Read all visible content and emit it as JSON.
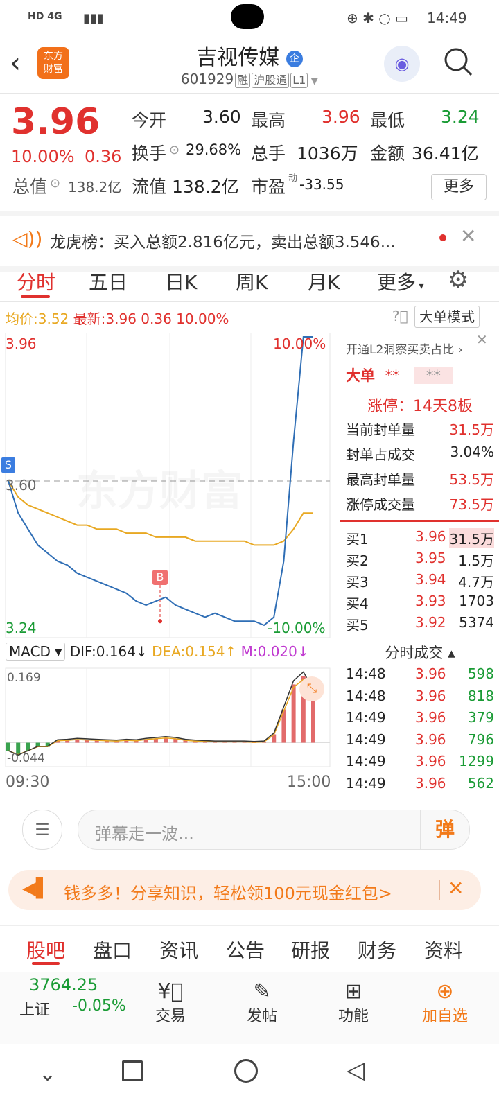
{
  "status_bar": {
    "left_icons": "HD 4G",
    "time": "14:49"
  },
  "header": {
    "stock_name": "吉视传媒",
    "stock_code": "601929",
    "tags": [
      "融",
      "沪股通",
      "L1"
    ]
  },
  "quote": {
    "price": "3.96",
    "change_pct": "10.00%",
    "change": "0.36",
    "open_label": "今开",
    "open": "3.60",
    "high_label": "最高",
    "high": "3.96",
    "low_label": "最低",
    "low": "3.24",
    "turnover_label": "换手",
    "turnover": "29.68%",
    "volume_label": "总手",
    "volume": "1036万",
    "amount_label": "金额",
    "amount": "36.41亿",
    "mktcap_label": "总值",
    "mktcap": "138.2亿",
    "float_label": "流值",
    "float_cap": "138.2亿",
    "pe_label": "市盈",
    "pe_sup": "动",
    "pe": "-33.55",
    "more_button": "更多"
  },
  "notice": {
    "text": "龙虎榜：买入总额2.816亿元，卖出总额3.546..."
  },
  "tabs": [
    "分时",
    "五日",
    "日K",
    "周K",
    "月K",
    "更多"
  ],
  "summary": {
    "avg_label": "均价:",
    "avg": "3.52",
    "latest_label": "最新:",
    "latest": "3.96",
    "change": "0.36",
    "pct": "10.00%",
    "mode_button": "大单模式"
  },
  "chart_data": {
    "type": "line",
    "price_top": "3.96",
    "price_bottom": "3.24",
    "pct_top": "10.00%",
    "pct_bottom": "-10.00%",
    "ref_price": "3.60",
    "time_start": "09:30",
    "time_end": "15:00",
    "watermark": "东方财富",
    "marker_s": "S",
    "marker_b": "B",
    "ylim": [
      3.24,
      3.96
    ],
    "price_series": [
      3.6,
      3.52,
      3.48,
      3.44,
      3.42,
      3.4,
      3.39,
      3.37,
      3.36,
      3.35,
      3.34,
      3.33,
      3.32,
      3.3,
      3.29,
      3.3,
      3.31,
      3.29,
      3.28,
      3.27,
      3.26,
      3.27,
      3.26,
      3.25,
      3.25,
      3.25,
      3.24,
      3.26,
      3.4,
      3.7,
      3.96,
      3.96
    ],
    "avg_series": [
      3.6,
      3.56,
      3.54,
      3.53,
      3.52,
      3.51,
      3.5,
      3.49,
      3.49,
      3.48,
      3.48,
      3.48,
      3.47,
      3.47,
      3.47,
      3.46,
      3.46,
      3.46,
      3.46,
      3.45,
      3.45,
      3.45,
      3.45,
      3.45,
      3.45,
      3.44,
      3.44,
      3.44,
      3.45,
      3.48,
      3.52,
      3.52
    ],
    "macd": {
      "label": "MACD",
      "dif_label": "DIF:",
      "dif": "0.164",
      "dea_label": "DEA:",
      "dea": "0.154",
      "m_label": "M:",
      "m": "0.020",
      "top": "0.169",
      "bottom": "-0.044",
      "hist": [
        -0.02,
        -0.03,
        -0.02,
        -0.01,
        -0.01,
        0.005,
        0.006,
        0.008,
        0.007,
        0.006,
        0.005,
        0.004,
        0.006,
        0.005,
        0.008,
        0.01,
        0.012,
        0.01,
        0.006,
        0.004,
        0.003,
        0.002,
        0.002,
        0.002,
        0.002,
        0.001,
        0.002,
        0.02,
        0.08,
        0.14,
        0.16,
        0.12
      ]
    }
  },
  "panel": {
    "l2_link": "开通L2洞察买卖占比",
    "big_order_label": "大单",
    "big_order_val1": "**",
    "big_order_val2": "**",
    "limit_up": "涨停：14天8板",
    "stats": [
      {
        "label": "当前封单量",
        "value": "31.5万"
      },
      {
        "label": "封单占成交",
        "value": "3.04%"
      },
      {
        "label": "最高封单量",
        "value": "53.5万"
      },
      {
        "label": "涨停成交量",
        "value": "73.5万"
      }
    ],
    "bids": [
      {
        "label": "买1",
        "price": "3.96",
        "vol": "31.5万"
      },
      {
        "label": "买2",
        "price": "3.95",
        "vol": "1.5万"
      },
      {
        "label": "买3",
        "price": "3.94",
        "vol": "4.7万"
      },
      {
        "label": "买4",
        "price": "3.93",
        "vol": "1703"
      },
      {
        "label": "买5",
        "price": "3.92",
        "vol": "5374"
      }
    ],
    "trades_title": "分时成交",
    "trades": [
      {
        "time": "14:48",
        "price": "3.96",
        "vol": "598"
      },
      {
        "time": "14:48",
        "price": "3.96",
        "vol": "818"
      },
      {
        "time": "14:49",
        "price": "3.96",
        "vol": "379"
      },
      {
        "time": "14:49",
        "price": "3.96",
        "vol": "796"
      },
      {
        "time": "14:49",
        "price": "3.96",
        "vol": "1299"
      },
      {
        "time": "14:49",
        "price": "3.96",
        "vol": "562"
      }
    ]
  },
  "comment": {
    "placeholder": "弹幕走一波...",
    "danmu_button": "弹"
  },
  "promo": {
    "text": "钱多多！分享知识，轻松领100元现金红包>"
  },
  "bottom_tabs": [
    "股吧",
    "盘口",
    "资讯",
    "公告",
    "研报",
    "财务",
    "资料"
  ],
  "toolbar": {
    "index_value": "3764.25",
    "index_name": "上证",
    "index_change": "-0.05%",
    "trade": "交易",
    "post": "发帖",
    "func": "功能",
    "add": "加自选"
  }
}
